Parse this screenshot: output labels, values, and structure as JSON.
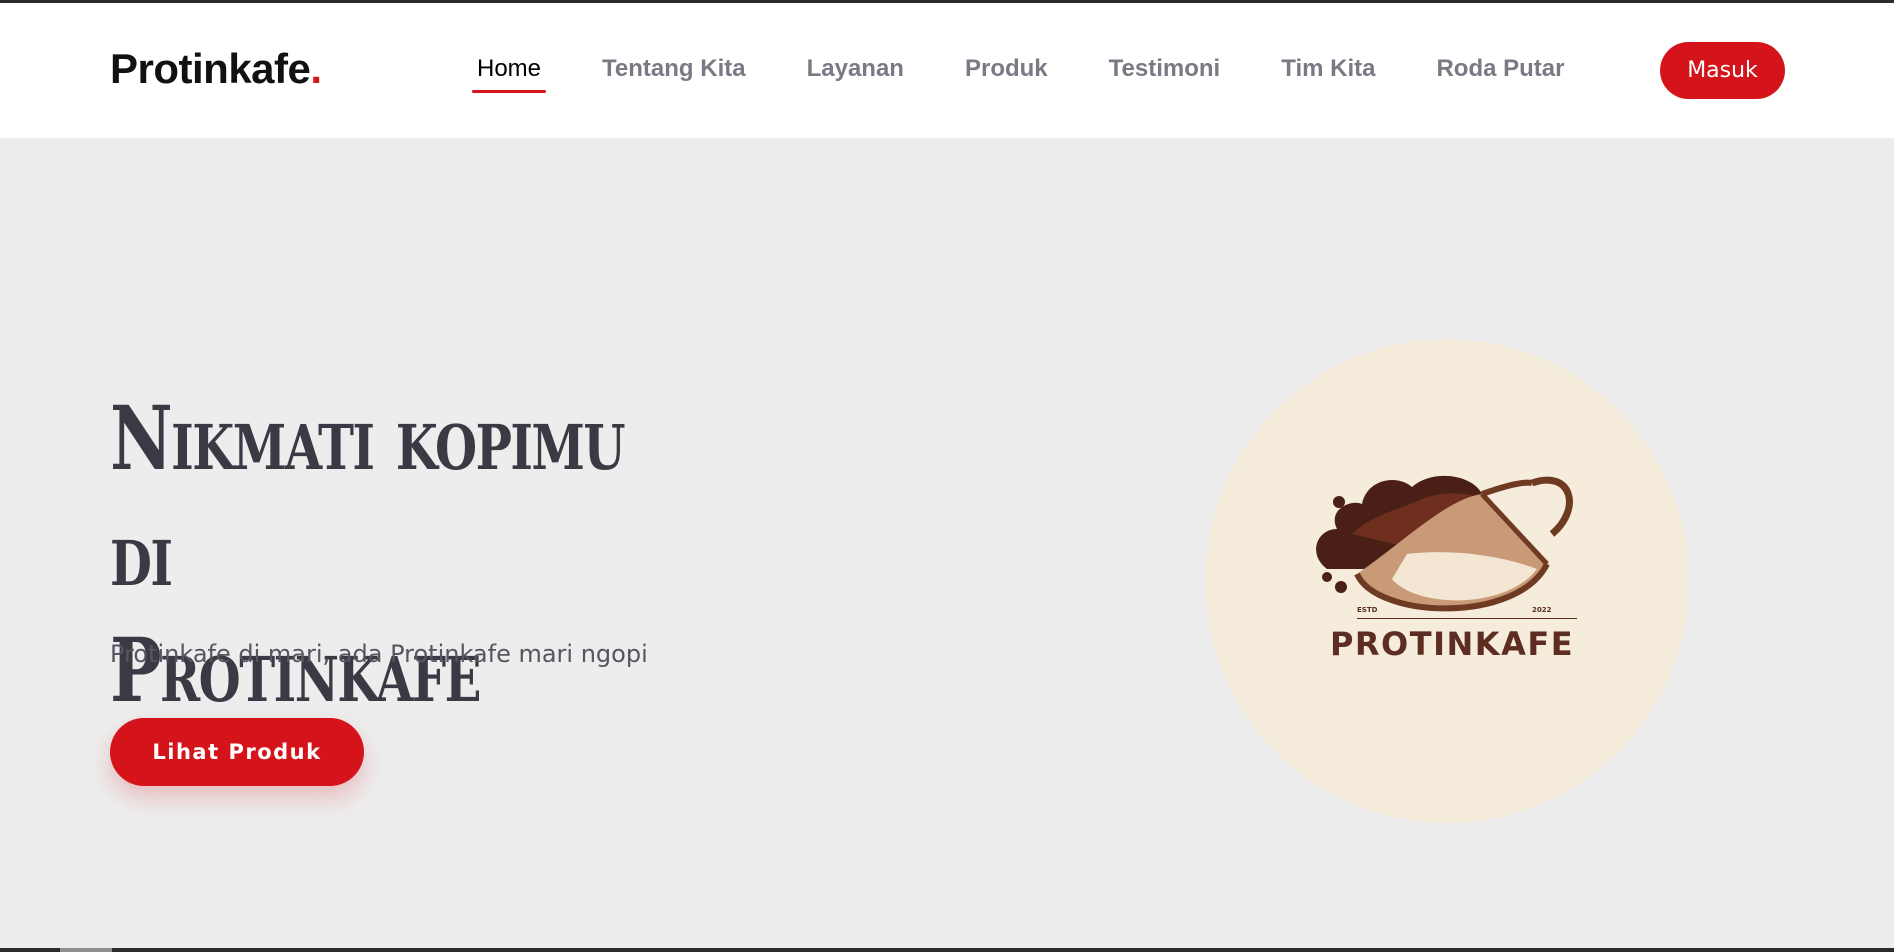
{
  "header": {
    "brand_name": "Protinkafe",
    "brand_dot": ".",
    "nav": [
      {
        "label": "Home",
        "active": true
      },
      {
        "label": "Tentang Kita"
      },
      {
        "label": "Layanan"
      },
      {
        "label": "Produk"
      },
      {
        "label": "Testimoni"
      },
      {
        "label": "Tim Kita"
      },
      {
        "label": "Roda Putar"
      }
    ],
    "login_label": "Masuk"
  },
  "hero": {
    "title_line1": "Nikmati kopimu di",
    "title_line2": "Protinkafe",
    "subtitle": "Protinkafe di mari, ada Protinkafe mari ngopi",
    "cta_label": "Lihat Produk"
  },
  "logo": {
    "wordmark": "PROTINKAFE",
    "estd": "ESTD",
    "year": "2022"
  },
  "colors": {
    "accent": "#d4141a",
    "page_bg": "#ededed",
    "header_bg": "#ffffff",
    "logo_circle": "#f5ecdc",
    "coffee_dark": "#5d2d22"
  }
}
